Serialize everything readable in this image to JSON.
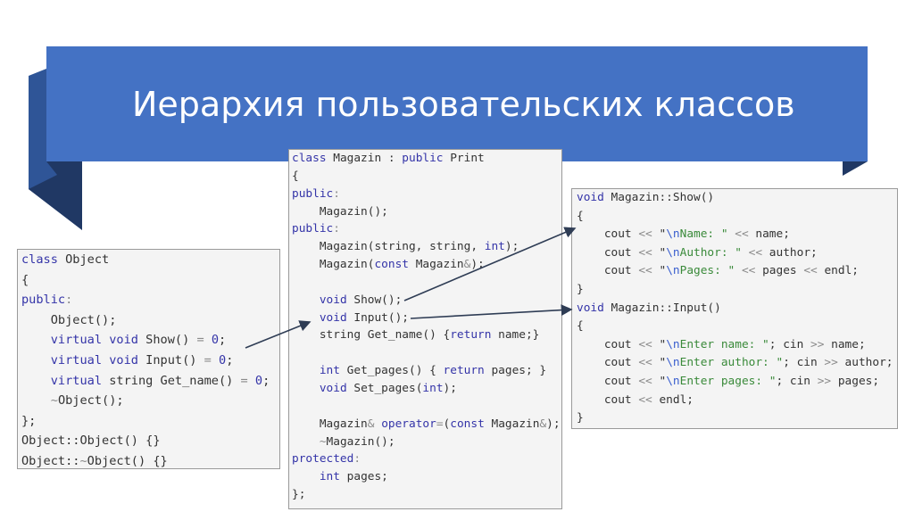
{
  "title": "Иерархия пользовательских классов",
  "colors": {
    "banner": "#4472c4",
    "banner_fold": "#2f5597",
    "banner_dark": "#203864"
  },
  "code_left": [
    [
      [
        "class",
        "k"
      ],
      [
        " Object",
        ""
      ]
    ],
    [
      [
        "{",
        ""
      ]
    ],
    [
      [
        "public",
        "k"
      ],
      [
        ":",
        "o"
      ]
    ],
    [
      [
        "    Object();",
        ""
      ]
    ],
    [
      [
        "    ",
        ""
      ],
      [
        "virtual",
        "k"
      ],
      [
        " ",
        ""
      ],
      [
        "void",
        "k"
      ],
      [
        " Show() ",
        ""
      ],
      [
        "=",
        "o"
      ],
      [
        " ",
        ""
      ],
      [
        "0",
        "n"
      ],
      [
        ";",
        ""
      ]
    ],
    [
      [
        "    ",
        ""
      ],
      [
        "virtual",
        "k"
      ],
      [
        " ",
        ""
      ],
      [
        "void",
        "k"
      ],
      [
        " Input() ",
        ""
      ],
      [
        "=",
        "o"
      ],
      [
        " ",
        ""
      ],
      [
        "0",
        "n"
      ],
      [
        ";",
        ""
      ]
    ],
    [
      [
        "    ",
        ""
      ],
      [
        "virtual",
        "k"
      ],
      [
        " string Get_name() ",
        ""
      ],
      [
        "=",
        "o"
      ],
      [
        " ",
        ""
      ],
      [
        "0",
        "n"
      ],
      [
        ";",
        ""
      ]
    ],
    [
      [
        "    ",
        ""
      ],
      [
        "~",
        "o"
      ],
      [
        "Object();",
        ""
      ]
    ],
    [
      [
        "};",
        ""
      ]
    ],
    [
      [
        "Object::Object() {}",
        ""
      ]
    ],
    [
      [
        "Object::",
        ""
      ],
      [
        "~",
        "o"
      ],
      [
        "Object() {}",
        ""
      ]
    ]
  ],
  "code_mid": [
    [
      [
        "class",
        "k"
      ],
      [
        " Magazin : ",
        ""
      ],
      [
        "public",
        "k"
      ],
      [
        " Print",
        ""
      ]
    ],
    [
      [
        "{",
        ""
      ]
    ],
    [
      [
        "public",
        "k"
      ],
      [
        ":",
        "o"
      ]
    ],
    [
      [
        "    Magazin();",
        ""
      ]
    ],
    [
      [
        "public",
        "k"
      ],
      [
        ":",
        "o"
      ]
    ],
    [
      [
        "    Magazin(string, string, ",
        ""
      ],
      [
        "int",
        "k"
      ],
      [
        ");",
        ""
      ]
    ],
    [
      [
        "    Magazin(",
        ""
      ],
      [
        "const",
        "k"
      ],
      [
        " Magazin",
        ""
      ],
      [
        "&",
        "o"
      ],
      [
        ");",
        ""
      ]
    ],
    [
      [
        "",
        ""
      ]
    ],
    [
      [
        "    ",
        ""
      ],
      [
        "void",
        "k"
      ],
      [
        " Show();",
        ""
      ]
    ],
    [
      [
        "    ",
        ""
      ],
      [
        "void",
        "k"
      ],
      [
        " Input();",
        ""
      ]
    ],
    [
      [
        "    string Get_name() {",
        ""
      ],
      [
        "return",
        "k"
      ],
      [
        " name;}",
        ""
      ]
    ],
    [
      [
        "",
        ""
      ]
    ],
    [
      [
        "    ",
        ""
      ],
      [
        "int",
        "k"
      ],
      [
        " Get_pages() { ",
        ""
      ],
      [
        "return",
        "k"
      ],
      [
        " pages; }",
        ""
      ]
    ],
    [
      [
        "    ",
        ""
      ],
      [
        "void",
        "k"
      ],
      [
        " Set_pages(",
        ""
      ],
      [
        "int",
        "k"
      ],
      [
        ");",
        ""
      ]
    ],
    [
      [
        "",
        ""
      ]
    ],
    [
      [
        "    Magazin",
        ""
      ],
      [
        "&",
        "o"
      ],
      [
        " ",
        ""
      ],
      [
        "operator",
        "k"
      ],
      [
        "=",
        "o"
      ],
      [
        "(",
        ""
      ],
      [
        "const",
        "k"
      ],
      [
        " Magazin",
        ""
      ],
      [
        "&",
        "o"
      ],
      [
        ");",
        ""
      ]
    ],
    [
      [
        "    ",
        ""
      ],
      [
        "~",
        "o"
      ],
      [
        "Magazin();",
        ""
      ]
    ],
    [
      [
        "protected",
        "k"
      ],
      [
        ":",
        "o"
      ]
    ],
    [
      [
        "    ",
        ""
      ],
      [
        "int",
        "k"
      ],
      [
        " pages;",
        ""
      ]
    ],
    [
      [
        "};",
        ""
      ]
    ]
  ],
  "code_right": [
    [
      [
        "void",
        "k"
      ],
      [
        " Magazin::Show()",
        ""
      ]
    ],
    [
      [
        "{",
        ""
      ]
    ],
    [
      [
        "    cout ",
        ""
      ],
      [
        "<<",
        "o"
      ],
      [
        " \"",
        ""
      ],
      [
        "\\n",
        "e"
      ],
      [
        "Name: \"",
        "s"
      ],
      [
        " ",
        ""
      ],
      [
        "<<",
        "o"
      ],
      [
        " name;",
        ""
      ]
    ],
    [
      [
        "    cout ",
        ""
      ],
      [
        "<<",
        "o"
      ],
      [
        " \"",
        ""
      ],
      [
        "\\n",
        "e"
      ],
      [
        "Author: \"",
        "s"
      ],
      [
        " ",
        ""
      ],
      [
        "<<",
        "o"
      ],
      [
        " author;",
        ""
      ]
    ],
    [
      [
        "    cout ",
        ""
      ],
      [
        "<<",
        "o"
      ],
      [
        " \"",
        ""
      ],
      [
        "\\n",
        "e"
      ],
      [
        "Pages: \"",
        "s"
      ],
      [
        " ",
        ""
      ],
      [
        "<<",
        "o"
      ],
      [
        " pages ",
        ""
      ],
      [
        "<<",
        "o"
      ],
      [
        " endl;",
        ""
      ]
    ],
    [
      [
        "}",
        ""
      ]
    ],
    [
      [
        "void",
        "k"
      ],
      [
        " Magazin::Input()",
        ""
      ]
    ],
    [
      [
        "{",
        ""
      ]
    ],
    [
      [
        "    cout ",
        ""
      ],
      [
        "<<",
        "o"
      ],
      [
        " \"",
        ""
      ],
      [
        "\\n",
        "e"
      ],
      [
        "Enter name: \"",
        "s"
      ],
      [
        "; cin ",
        ""
      ],
      [
        ">>",
        "o"
      ],
      [
        " name;",
        ""
      ]
    ],
    [
      [
        "    cout ",
        ""
      ],
      [
        "<<",
        "o"
      ],
      [
        " \"",
        ""
      ],
      [
        "\\n",
        "e"
      ],
      [
        "Enter author: \"",
        "s"
      ],
      [
        "; cin ",
        ""
      ],
      [
        ">>",
        "o"
      ],
      [
        " author;",
        ""
      ]
    ],
    [
      [
        "    cout ",
        ""
      ],
      [
        "<<",
        "o"
      ],
      [
        " \"",
        ""
      ],
      [
        "\\n",
        "e"
      ],
      [
        "Enter pages: \"",
        "s"
      ],
      [
        "; cin ",
        ""
      ],
      [
        ">>",
        "o"
      ],
      [
        " pages;",
        ""
      ]
    ],
    [
      [
        "    cout ",
        ""
      ],
      [
        "<<",
        "o"
      ],
      [
        " endl;",
        ""
      ]
    ],
    [
      [
        "}",
        ""
      ]
    ]
  ]
}
